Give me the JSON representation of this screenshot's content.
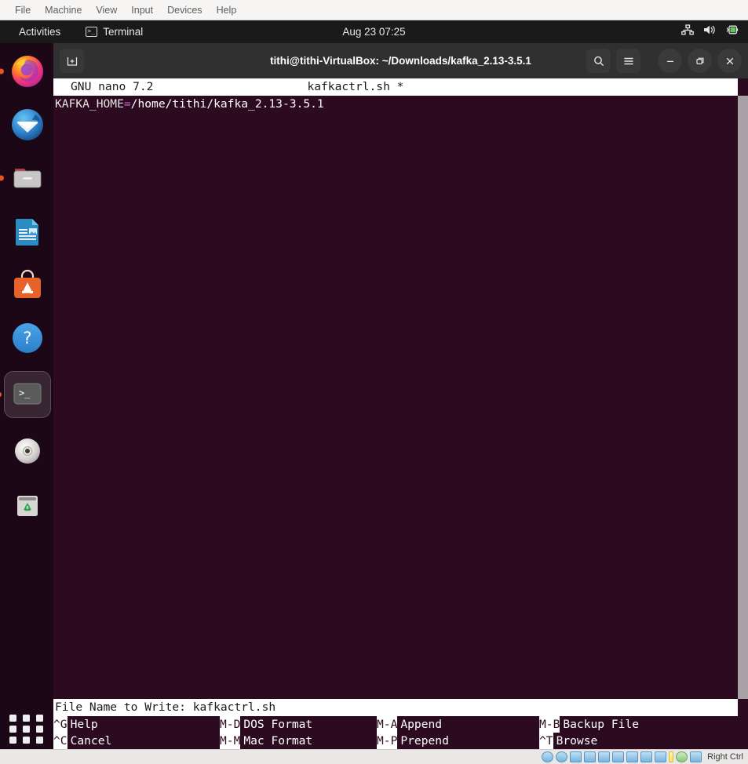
{
  "vbox": {
    "menu": [
      "File",
      "Machine",
      "View",
      "Input",
      "Devices",
      "Help"
    ],
    "statusbar_label": "Right Ctrl"
  },
  "gnome_panel": {
    "activities": "Activities",
    "app_name": "Terminal",
    "clock": "Aug 23  07:25",
    "status_icons": [
      "network-wired-icon",
      "volume-icon",
      "battery-icon"
    ]
  },
  "dock": {
    "items": [
      {
        "name": "firefox",
        "label": "Firefox",
        "running": true,
        "active": false
      },
      {
        "name": "thunderbird",
        "label": "Thunderbird",
        "running": false,
        "active": false
      },
      {
        "name": "files",
        "label": "Files",
        "running": true,
        "active": false
      },
      {
        "name": "libreoffice-writer",
        "label": "LibreOffice Writer",
        "running": false,
        "active": false
      },
      {
        "name": "ubuntu-software",
        "label": "Ubuntu Software",
        "running": false,
        "active": false
      },
      {
        "name": "help",
        "label": "Help",
        "running": false,
        "active": false
      },
      {
        "name": "terminal",
        "label": "Terminal",
        "running": true,
        "active": true
      },
      {
        "name": "disc",
        "label": "Disc Image",
        "running": false,
        "active": false
      },
      {
        "name": "trash",
        "label": "Trash",
        "running": false,
        "active": false
      }
    ],
    "show_apps_label": "Show Applications"
  },
  "terminal": {
    "title": "tithi@tithi-VirtualBox: ~/Downloads/kafka_2.13-3.5.1",
    "new_tab_icon": "new-tab-icon",
    "search_icon": "search-icon",
    "menu_icon": "hamburger-menu-icon",
    "minimize_icon": "minimize-icon",
    "maximize_icon": "maximize-icon",
    "close_icon": "close-icon",
    "bg_color": "#2c0b20"
  },
  "nano": {
    "version": "GNU nano 7.2",
    "filename": "kafkactrl.sh *",
    "content_lines": [
      {
        "var": "KAFKA_HOME",
        "eq": "=",
        "path": "/home/tithi/kafka_2.13-3.5.1"
      }
    ],
    "prompt": "File Name to Write: kafkactrl.sh",
    "shortcuts": [
      [
        {
          "key": "^G",
          "label": "Help"
        },
        {
          "key": "M-D",
          "label": "DOS Format"
        },
        {
          "key": "M-A",
          "label": "Append"
        },
        {
          "key": "M-B",
          "label": "Backup File"
        }
      ],
      [
        {
          "key": "^C",
          "label": "Cancel"
        },
        {
          "key": "M-M",
          "label": "Mac Format"
        },
        {
          "key": "M-P",
          "label": "Prepend"
        },
        {
          "key": "^T",
          "label": "Browse"
        }
      ]
    ]
  }
}
